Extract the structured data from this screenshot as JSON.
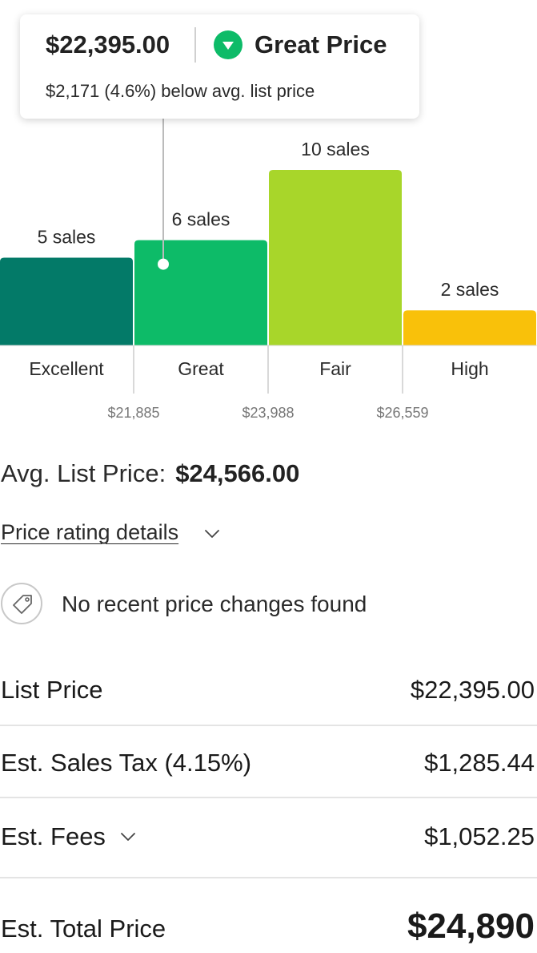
{
  "tooltip": {
    "price": "$22,395.00",
    "rating": "Great Price",
    "subtext": "$2,171 (4.6%) below avg. list price",
    "rating_color": "#0dbb68",
    "icon": "triangle-down-icon"
  },
  "chart_data": {
    "type": "bar",
    "categories": [
      "Excellent",
      "Great",
      "Fair",
      "High"
    ],
    "values": [
      5,
      6,
      10,
      2
    ],
    "data_labels": [
      "5 sales",
      "6 sales",
      "10 sales",
      "2 sales"
    ],
    "colors": [
      "#037a68",
      "#0dbb68",
      "#a8d62a",
      "#f9c10a"
    ],
    "thresholds": [
      "$21,885",
      "$23,988",
      "$26,559"
    ],
    "current_marker_category": "Great",
    "grid": false,
    "legend": "none"
  },
  "avg": {
    "label": "Avg. List Price:",
    "value": "$24,566.00"
  },
  "details": {
    "label": "Price rating details",
    "icon": "chevron-down-icon"
  },
  "price_changes": {
    "icon": "price-tag-icon",
    "text": "No recent price changes found"
  },
  "breakdown": {
    "list_price": {
      "label": "List Price",
      "value": "$22,395.00"
    },
    "sales_tax": {
      "label": "Est. Sales Tax (4.15%)",
      "value": "$1,285.44"
    },
    "fees": {
      "label": "Est. Fees",
      "value": "$1,052.25",
      "icon": "chevron-down-icon"
    },
    "total": {
      "label": "Est. Total Price",
      "value": "$24,890"
    }
  }
}
